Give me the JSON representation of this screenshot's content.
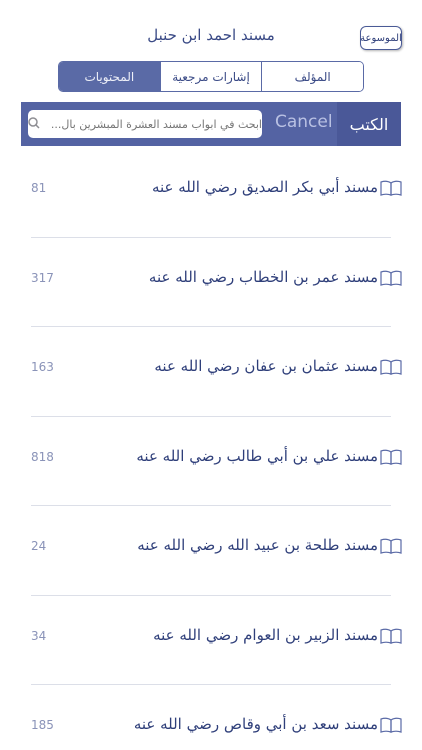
{
  "header": {
    "title": "مسند احمد ابن حنبل",
    "encyclopedia_button": "الموسوعة"
  },
  "tabs": [
    {
      "label": "المؤلف",
      "active": false
    },
    {
      "label": "إشارات مرجعية",
      "active": false
    },
    {
      "label": "المحتويات",
      "active": true
    }
  ],
  "search": {
    "placeholder": "ابحث في ابواب مسند العشرة المبشرين بال...",
    "cancel_label": "Cancel",
    "books_label": "الكتب"
  },
  "items": [
    {
      "title": "مسند أبي بكر الصديق رضي الله عنه",
      "count": "81"
    },
    {
      "title": "مسند عمر بن الخطاب رضي الله عنه",
      "count": "317"
    },
    {
      "title": "مسند عثمان بن عفان رضي الله عنه",
      "count": "163"
    },
    {
      "title": "مسند علي بن أبي طالب رضي الله عنه",
      "count": "818"
    },
    {
      "title": "مسند طلحة بن عبيد الله رضي الله عنه",
      "count": "24"
    },
    {
      "title": "مسند الزبير بن العوام رضي الله عنه",
      "count": "34"
    },
    {
      "title": "مسند سعد بن أبي وقاص رضي الله عنه",
      "count": "185"
    }
  ],
  "colors": {
    "accent": "#5463a3",
    "text": "#2f3f7a",
    "muted": "#8a93b8"
  },
  "icons": {
    "book": "open-book-icon",
    "search": "search-icon"
  }
}
